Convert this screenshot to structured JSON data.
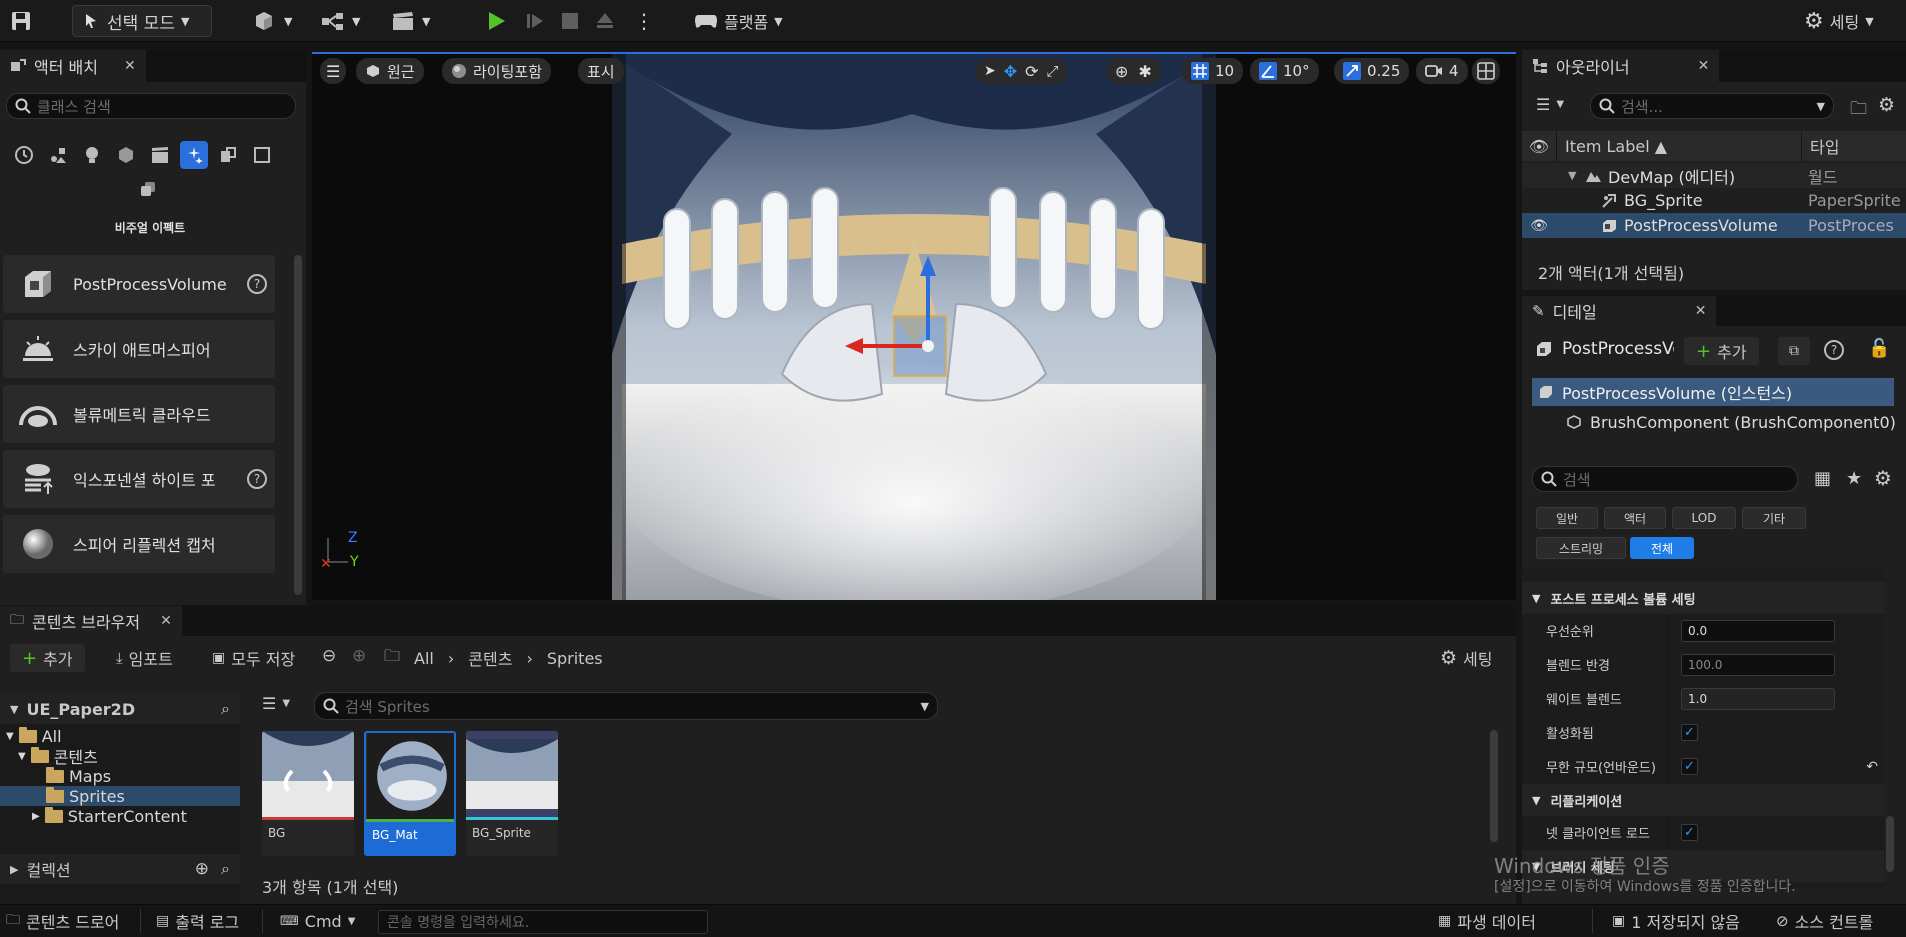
{
  "toolbar": {
    "mode_label": "선택 모드",
    "platform_label": "플랫폼",
    "settings_label": "세팅"
  },
  "place_actors": {
    "tab_label": "액터 배치",
    "search_placeholder": "클래스 검색",
    "category_label": "비주얼 이펙트",
    "items": [
      {
        "label": "PostProcessVolume"
      },
      {
        "label": "스카이 애트머스피어"
      },
      {
        "label": "볼류메트릭 클라우드"
      },
      {
        "label": "익스포넨셜 하이트 포"
      },
      {
        "label": "스피어 리플렉션 캡처"
      }
    ]
  },
  "viewport": {
    "perspective_label": "원근",
    "lighting_label": "라이팅포함",
    "show_label": "표시",
    "grid_snap": "10",
    "rotation_snap": "10°",
    "scale_snap": "0.25",
    "camera_speed": "4",
    "axis_z": "Z",
    "axis_y": "Y"
  },
  "outliner": {
    "tab_label": "아웃라이너",
    "search_placeholder": "검색...",
    "col_label": "Item Label",
    "col_type": "타입",
    "rows": [
      {
        "label": "DevMap (에디터)",
        "type": "월드"
      },
      {
        "label": "BG_Sprite",
        "type": "PaperSprite"
      },
      {
        "label": "PostProcessVolume",
        "type": "PostProces"
      }
    ],
    "status": "2개 액터(1개 선택됨)"
  },
  "details": {
    "tab_label": "디테일",
    "object_name": "PostProcessVolume",
    "add_label": "추가",
    "components": [
      "PostProcessVolume (인스턴스)",
      "BrushComponent (BrushComponent0)"
    ],
    "search_placeholder": "검색",
    "filters": [
      "일반",
      "액터",
      "LOD",
      "기타",
      "스트리밍",
      "전체"
    ],
    "section1": "포스트 프로세스 볼륨 세팅",
    "props": [
      {
        "label": "우선순위",
        "value": "0.0"
      },
      {
        "label": "블렌드 반경",
        "value": "100.0"
      },
      {
        "label": "웨이트 블렌드",
        "value": "1.0"
      },
      {
        "label": "활성화됨",
        "checked": true
      },
      {
        "label": "무한 규모(언바운드)",
        "checked": true
      }
    ],
    "section2": "리플리케이션",
    "props2": [
      {
        "label": "넷 클라이언트 로드",
        "checked": true
      }
    ],
    "section3": "브러시 세팅"
  },
  "content_browser": {
    "tab_label": "콘텐츠 브라우저",
    "add_label": "추가",
    "import_label": "임포트",
    "save_all_label": "모두 저장",
    "path": [
      "All",
      "콘텐츠",
      "Sprites"
    ],
    "settings_label": "세팅",
    "project_name": "UE_Paper2D",
    "tree": [
      "All",
      "콘텐츠",
      "Maps",
      "Sprites",
      "StarterContent"
    ],
    "collections_label": "컬렉션",
    "search_placeholder": "검색 Sprites",
    "assets": [
      {
        "name": "BG",
        "bar_color": "#c93b3b"
      },
      {
        "name": "BG_Mat",
        "bar_color": "#46b34a"
      },
      {
        "name": "BG_Sprite",
        "bar_color": "#37c6d8"
      }
    ],
    "item_count": "3개 항목 (1개 선택)"
  },
  "statusbar": {
    "content_drawer": "콘텐츠 드로어",
    "output_log": "출력 로그",
    "cmd_label": "Cmd",
    "console_placeholder": "콘솔 명령을 입력하세요.",
    "derived_data": "파생 데이터",
    "unsaved": "1 저장되지 않음",
    "source_control": "소스 컨트롤"
  },
  "watermark": {
    "line1": "Windows 정품 인증",
    "line2": "[설정]으로 이동하여 Windows를 정품 인증합니다."
  },
  "colors": {
    "accent_blue": "#2a6fdc",
    "selection": "#2c4a6a",
    "play_green": "#56c22a",
    "folder": "#c9a75e"
  }
}
